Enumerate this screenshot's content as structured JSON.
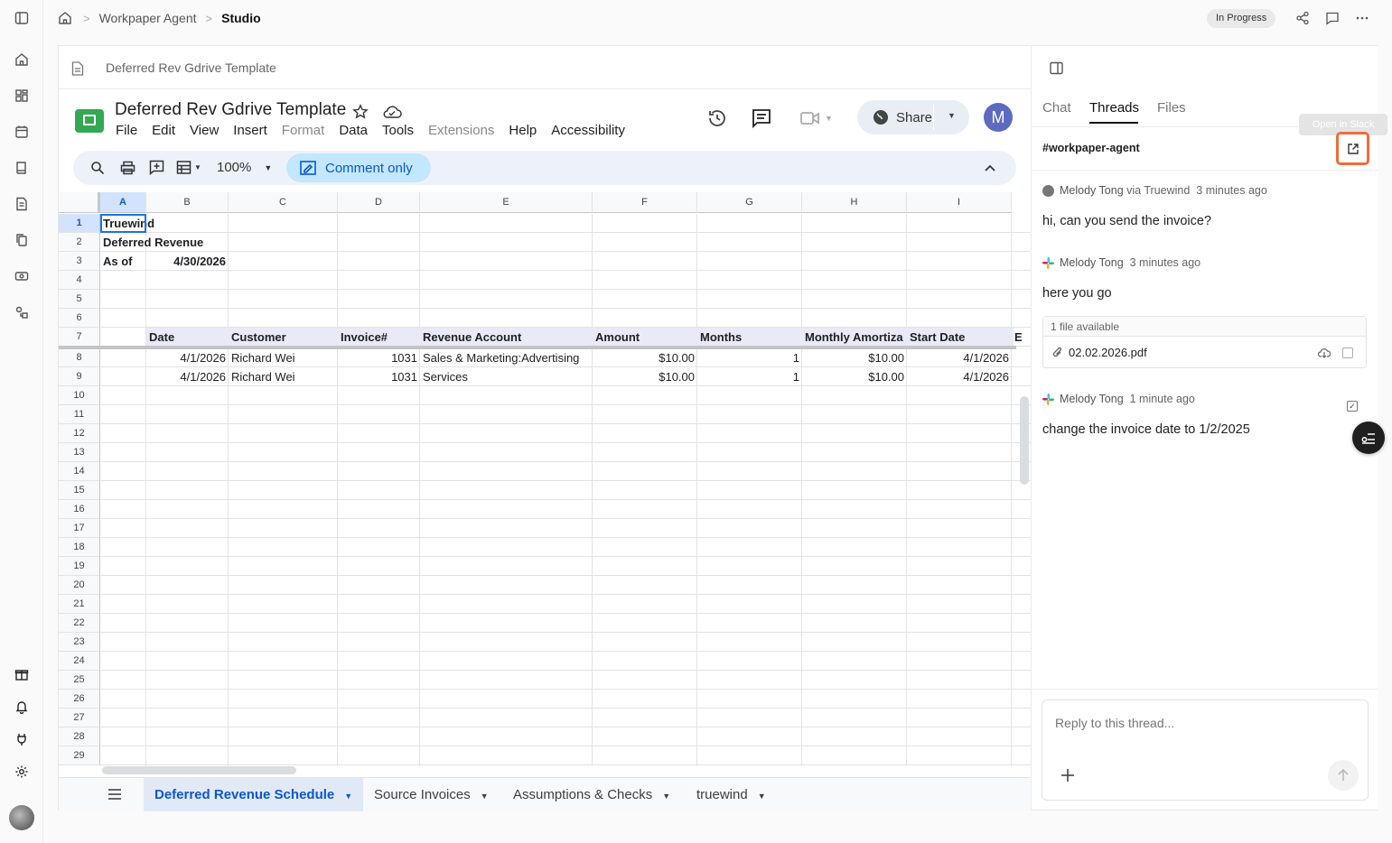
{
  "breadcrumb": {
    "root": "Workpaper Agent",
    "current": "Studio"
  },
  "status_badge": "In Progress",
  "doc_header_title": "Deferred Rev Gdrive Template",
  "sheet": {
    "title": "Deferred Rev Gdrive Template",
    "menu": [
      "File",
      "Edit",
      "View",
      "Insert",
      "Format",
      "Data",
      "Tools",
      "Extensions",
      "Help",
      "Accessibility"
    ],
    "share_label": "Share",
    "avatar_letter": "M",
    "zoom": "100%",
    "mode_label": "Comment only",
    "columns": [
      "A",
      "B",
      "C",
      "D",
      "E",
      "F",
      "G",
      "H",
      "I"
    ],
    "rows": [
      "1",
      "2",
      "3",
      "4",
      "5",
      "6",
      "7",
      "8",
      "9",
      "10",
      "11",
      "12",
      "13",
      "14",
      "15",
      "16",
      "17",
      "18",
      "19",
      "20",
      "21",
      "22",
      "23",
      "24",
      "25",
      "26",
      "27",
      "28",
      "29"
    ],
    "cells": {
      "a1": "Truewind",
      "a2": "Deferred Revenue",
      "a3": "As of",
      "b3": "4/30/2026",
      "headers": [
        "Date",
        "Customer",
        "Invoice#",
        "Revenue Account",
        "Amount",
        "Months",
        "Monthly Amortiza",
        "Start Date",
        "E"
      ],
      "data_rows": [
        [
          "4/1/2026",
          "Richard Wei",
          "1031",
          "Sales & Marketing:Advertising",
          "$10.00",
          "1",
          "$10.00",
          "4/1/2026"
        ],
        [
          "4/1/2026",
          "Richard Wei",
          "1031",
          "Services",
          "$10.00",
          "1",
          "$10.00",
          "4/1/2026"
        ]
      ]
    },
    "tabs": [
      "Deferred Revenue Schedule",
      "Source Invoices",
      "Assumptions & Checks",
      "truewind"
    ]
  },
  "panel": {
    "tabs": [
      "Chat",
      "Threads",
      "Files"
    ],
    "active_tab": "Threads",
    "channel": "#workpaper-agent",
    "tooltip": "Open in Slack",
    "messages": [
      {
        "author": "Melody Tong",
        "via": "via Truewind",
        "time": "3 minutes ago",
        "text": "hi, can you send the invoice?"
      },
      {
        "author": "Melody Tong",
        "via": "",
        "time": "3 minutes ago",
        "text": "here you go"
      },
      {
        "author": "Melody Tong",
        "via": "",
        "time": "1 minute ago",
        "text": "change the invoice date to 1/2/2025"
      }
    ],
    "attachment": {
      "count_label": "1 file available",
      "filename": "02.02.2026.pdf"
    },
    "reply_placeholder": "Reply to this thread..."
  },
  "colors": {
    "accent_blue": "#0b57d0",
    "highlight": "#f26b3a",
    "sheets_green": "#188038"
  }
}
